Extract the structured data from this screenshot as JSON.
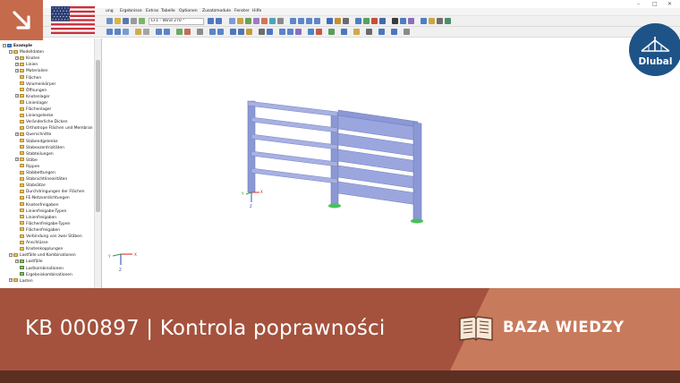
{
  "window": {
    "minimize_label": "–",
    "maximize_label": "□",
    "close_label": "✕"
  },
  "menu": {
    "items": [
      "ung",
      "Ergebnisse",
      "Extras",
      "Tabelle",
      "Optionen",
      "Zusatzmodule",
      "Fenster",
      "Hilfe"
    ]
  },
  "toolbar": {
    "loadcase_combo": "LF1 - Wind 270 °"
  },
  "navigator": {
    "items": [
      {
        "label": "Example",
        "level": 0,
        "icon": "b",
        "expander": "−"
      },
      {
        "label": "Modelldaten",
        "level": 1,
        "icon": "y",
        "expander": "−"
      },
      {
        "label": "Knoten",
        "level": 2,
        "icon": "y",
        "expander": "+"
      },
      {
        "label": "Linien",
        "level": 2,
        "icon": "y",
        "expander": "+"
      },
      {
        "label": "Materialien",
        "level": 2,
        "icon": "y",
        "expander": "+"
      },
      {
        "label": "Flächen",
        "level": 2,
        "icon": "y",
        "expander": ""
      },
      {
        "label": "Volumenkörper",
        "level": 2,
        "icon": "y",
        "expander": ""
      },
      {
        "label": "Öffnungen",
        "level": 2,
        "icon": "y",
        "expander": ""
      },
      {
        "label": "Knotenlager",
        "level": 2,
        "icon": "y",
        "expander": "+"
      },
      {
        "label": "Linienlager",
        "level": 2,
        "icon": "y",
        "expander": ""
      },
      {
        "label": "Flächenlager",
        "level": 2,
        "icon": "y",
        "expander": ""
      },
      {
        "label": "Liniengelenke",
        "level": 2,
        "icon": "y",
        "expander": ""
      },
      {
        "label": "Veränderliche Dicken",
        "level": 2,
        "icon": "y",
        "expander": ""
      },
      {
        "label": "Orthotrope Flächen und Membran",
        "level": 2,
        "icon": "y",
        "expander": ""
      },
      {
        "label": "Querschnitte",
        "level": 2,
        "icon": "y",
        "expander": "+"
      },
      {
        "label": "Stabendgelenke",
        "level": 2,
        "icon": "y",
        "expander": ""
      },
      {
        "label": "Stabexzentrizitäten",
        "level": 2,
        "icon": "y",
        "expander": ""
      },
      {
        "label": "Stabteilungen",
        "level": 2,
        "icon": "y",
        "expander": ""
      },
      {
        "label": "Stäbe",
        "level": 2,
        "icon": "y",
        "expander": "+"
      },
      {
        "label": "Rippen",
        "level": 2,
        "icon": "y",
        "expander": ""
      },
      {
        "label": "Stabbettungen",
        "level": 2,
        "icon": "y",
        "expander": ""
      },
      {
        "label": "Stabnichtlinearitäten",
        "level": 2,
        "icon": "y",
        "expander": ""
      },
      {
        "label": "Stabsätze",
        "level": 2,
        "icon": "y",
        "expander": ""
      },
      {
        "label": "Durchdringungen der Flächen",
        "level": 2,
        "icon": "y",
        "expander": ""
      },
      {
        "label": "FE-Netzverdichtungen",
        "level": 2,
        "icon": "y",
        "expander": ""
      },
      {
        "label": "Knotenfreigaben",
        "level": 2,
        "icon": "y",
        "expander": ""
      },
      {
        "label": "Linienfreigabe-Typen",
        "level": 2,
        "icon": "y",
        "expander": ""
      },
      {
        "label": "Linienfreigaben",
        "level": 2,
        "icon": "y",
        "expander": ""
      },
      {
        "label": "Flächenfreigabe-Typen",
        "level": 2,
        "icon": "y",
        "expander": ""
      },
      {
        "label": "Flächenfreigaben",
        "level": 2,
        "icon": "y",
        "expander": ""
      },
      {
        "label": "Verbindung von zwei Stäben",
        "level": 2,
        "icon": "y",
        "expander": ""
      },
      {
        "label": "Anschlüsse",
        "level": 2,
        "icon": "y",
        "expander": ""
      },
      {
        "label": "Knotenkopplungen",
        "level": 2,
        "icon": "y",
        "expander": ""
      },
      {
        "label": "Lastfälle und Kombinationen",
        "level": 1,
        "icon": "y",
        "expander": "−"
      },
      {
        "label": "Lastfälle",
        "level": 2,
        "icon": "g",
        "expander": "+"
      },
      {
        "label": "Lastkombinationen",
        "level": 2,
        "icon": "g",
        "expander": ""
      },
      {
        "label": "Ergebniskombinationen",
        "level": 2,
        "icon": "g",
        "expander": ""
      },
      {
        "label": "Lasten",
        "level": 1,
        "icon": "y",
        "expander": "+"
      }
    ]
  },
  "axes": {
    "x": "X",
    "y": "Y",
    "z": "Z"
  },
  "brand": {
    "logo_text": "Dlubal"
  },
  "banner": {
    "title": "KB 000897 | Kontrola poprawności",
    "category": "BAZA WIEDZY"
  },
  "colors": {
    "brand_orange": "#c56b4c",
    "banner_dark": "#a4523d",
    "banner_light": "#c87a5c",
    "dlubal_blue": "#1e5388",
    "member_blue": "#8e9bd8"
  }
}
